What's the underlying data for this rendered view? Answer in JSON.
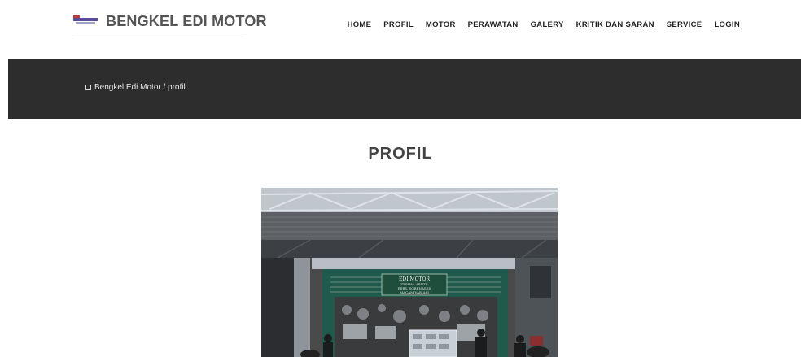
{
  "brand": {
    "name": "BENGKEL EDI MOTOR"
  },
  "nav": {
    "items": [
      "HOME",
      "PROFIL",
      "MOTOR",
      "PERAWATAN",
      "GALERY",
      "KRITIK DAN SARAN",
      "SERVICE",
      "LOGIN"
    ]
  },
  "breadcrumb": {
    "text": "Bengkel Edi Motor / profil"
  },
  "page": {
    "title": "PROFIL"
  },
  "photo": {
    "sign_line1": "EDI MOTOR",
    "sign_line2": "TERIMA ARUTS",
    "sign_line3": "PERS. SORENASES",
    "sign_line4": "MACAM VARIASI"
  },
  "colors": {
    "banner": "#2d2d2d",
    "nav_text": "#222222",
    "brand_text": "#555555"
  }
}
